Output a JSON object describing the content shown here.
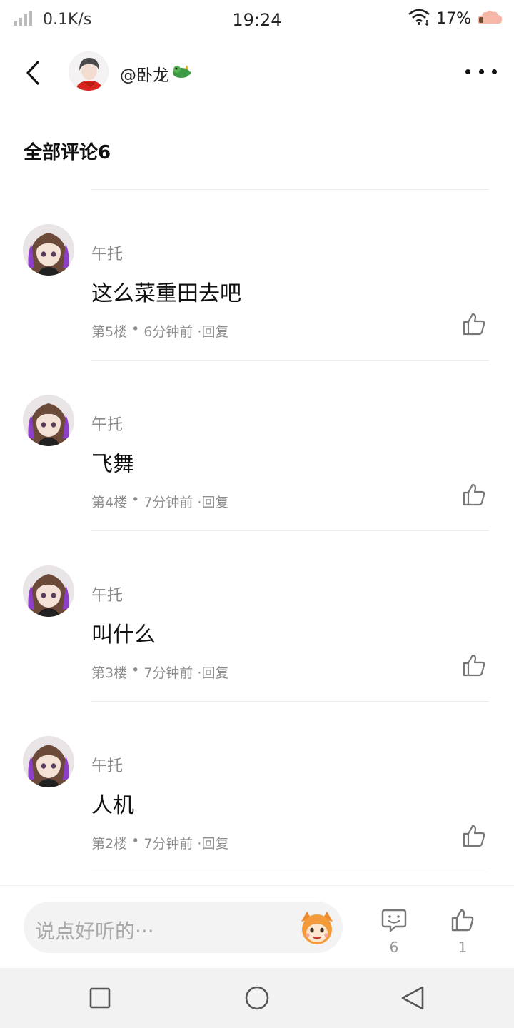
{
  "status_bar": {
    "speed": "0.1K/s",
    "time": "19:24",
    "battery": "17%"
  },
  "header": {
    "username": "@卧龙"
  },
  "section": {
    "title": "全部评论6"
  },
  "comments": [
    {
      "author": "午托",
      "text": "这么菜重田去吧",
      "floor": "第5楼",
      "time": "6分钟前",
      "reply": "·回复"
    },
    {
      "author": "午托",
      "text": "飞舞",
      "floor": "第4楼",
      "time": "7分钟前",
      "reply": "·回复"
    },
    {
      "author": "午托",
      "text": "叫什么",
      "floor": "第3楼",
      "time": "7分钟前",
      "reply": "·回复"
    },
    {
      "author": "午托",
      "text": "人机",
      "floor": "第2楼",
      "time": "7分钟前",
      "reply": "·回复"
    }
  ],
  "bottom_bar": {
    "placeholder": "说点好听的···",
    "comment_count": "6",
    "like_count": "1"
  },
  "colors": {
    "meta_gray": "#8c8c8c",
    "divider": "#ececec",
    "input_bg": "#f3f3f3",
    "nav_bg": "#f2f2f2"
  },
  "icons": [
    "signal-icon",
    "wifi-icon",
    "battery-icon",
    "back-icon",
    "dragon-emoji-icon",
    "more-icon",
    "like-icon",
    "emoji-icon",
    "comment-icon",
    "square-icon",
    "circle-icon",
    "triangle-icon"
  ]
}
